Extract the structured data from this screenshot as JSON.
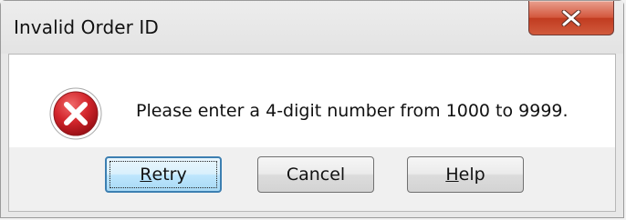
{
  "dialog": {
    "title": "Invalid Order ID",
    "message": "Please enter a 4-digit number from 1000 to 9999.",
    "icon": "error-icon"
  },
  "buttons": {
    "retry": {
      "mnemonic": "R",
      "rest": "etry"
    },
    "cancel": {
      "label": "Cancel"
    },
    "help": {
      "mnemonic": "H",
      "rest": "elp"
    }
  },
  "colors": {
    "close_button": "#c94a2f",
    "error_red": "#c8202a",
    "default_button_border": "#3c7fb1"
  }
}
